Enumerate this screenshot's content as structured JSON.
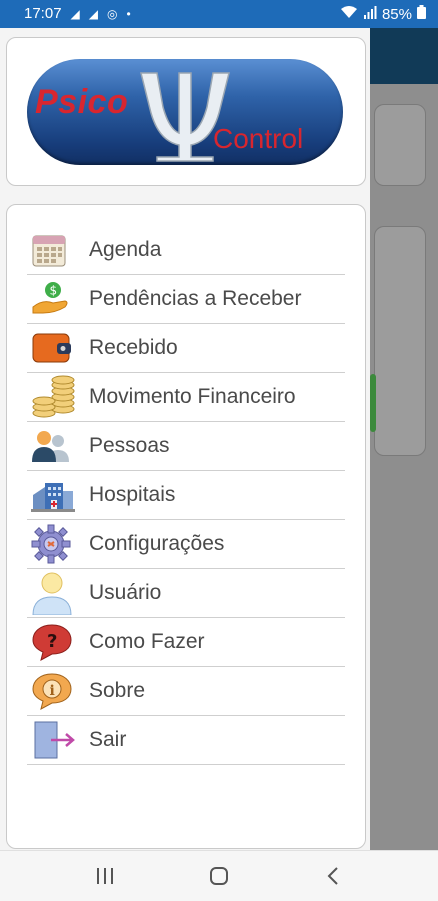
{
  "status_bar": {
    "time": "17:07",
    "notification_icons": [
      "navigation-arrow-icon",
      "navigation-arrow-icon",
      "target-icon",
      "dot-icon"
    ],
    "battery_percent": "85%",
    "system_icons": [
      "wifi-icon",
      "signal-icon",
      "battery-icon"
    ]
  },
  "logo": {
    "word1": "Psico",
    "word2": "Control",
    "symbol": "Ψ"
  },
  "menu": {
    "items": [
      {
        "label": "Agenda",
        "icon": "calendar-icon"
      },
      {
        "label": "Pendências a Receber",
        "icon": "money-hand-icon"
      },
      {
        "label": "Recebido",
        "icon": "wallet-icon"
      },
      {
        "label": "Movimento Financeiro",
        "icon": "coins-icon"
      },
      {
        "label": "Pessoas",
        "icon": "people-icon"
      },
      {
        "label": "Hospitais",
        "icon": "hospital-icon"
      },
      {
        "label": "Configurações",
        "icon": "gear-icon"
      },
      {
        "label": "Usuário",
        "icon": "user-icon"
      },
      {
        "label": "Como Fazer",
        "icon": "question-bubble-icon"
      },
      {
        "label": "Sobre",
        "icon": "info-bubble-icon"
      },
      {
        "label": "Sair",
        "icon": "exit-door-icon"
      }
    ]
  },
  "nav_bar": {
    "buttons": [
      "recent-apps-icon",
      "home-icon",
      "back-icon"
    ]
  },
  "colors": {
    "status_bar": "#1e6bb8",
    "logo_red": "#d8262f",
    "logo_blue": "#2f63a9"
  }
}
